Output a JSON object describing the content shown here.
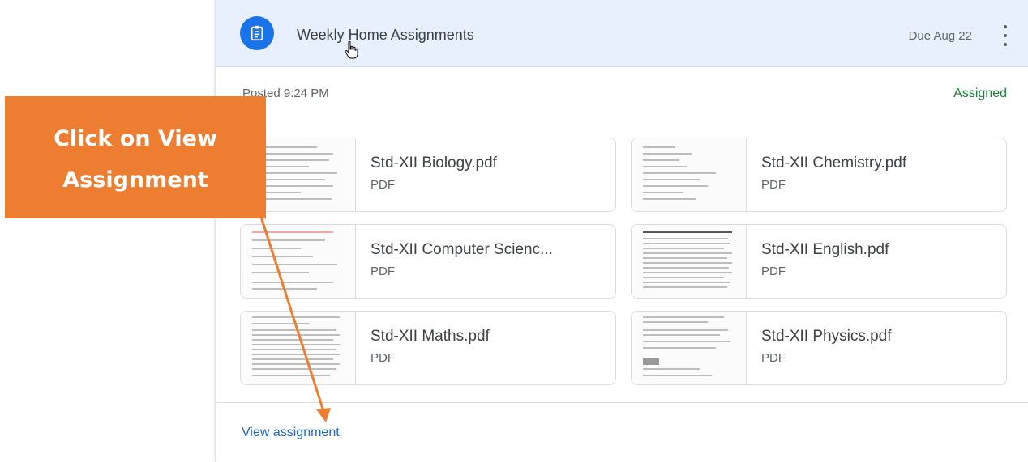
{
  "assignment": {
    "title": "Weekly Home Assignments",
    "due": "Due Aug 22",
    "posted": "Posted 9:24 PM",
    "status": "Assigned",
    "status_color": "#188038",
    "icon": "assignment-icon"
  },
  "files": [
    {
      "name": "Std-XII Biology.pdf",
      "type": "PDF"
    },
    {
      "name": "Std-XII Chemistry.pdf",
      "type": "PDF"
    },
    {
      "name": "Std-XII Computer Scienc...",
      "type": "PDF"
    },
    {
      "name": "Std-XII English.pdf",
      "type": "PDF"
    },
    {
      "name": "Std-XII Maths.pdf",
      "type": "PDF"
    },
    {
      "name": "Std-XII Physics.pdf",
      "type": "PDF"
    }
  ],
  "footer": {
    "view_label": "View assignment",
    "link_color": "#1967d2"
  },
  "annotation": {
    "line1": "Click on View",
    "line2": "Assignment",
    "color": "#ed7d31"
  }
}
